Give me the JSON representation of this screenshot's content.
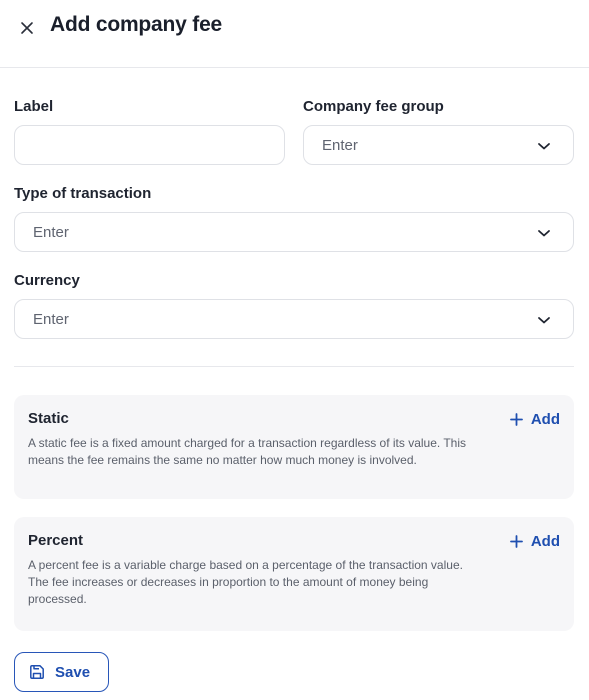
{
  "header": {
    "title": "Add company fee",
    "close_icon": "close-icon"
  },
  "form": {
    "label": {
      "label": "Label",
      "value": "",
      "placeholder": ""
    },
    "company_fee_group": {
      "label": "Company fee group",
      "value": "Enter"
    },
    "type_of_transaction": {
      "label": "Type of transaction",
      "value": "Enter"
    },
    "currency": {
      "label": "Currency",
      "value": "Enter"
    }
  },
  "fees": {
    "static": {
      "title": "Static",
      "description": "A static fee is a fixed amount charged for a transaction regardless of its value. This means the fee remains the same no matter how much money is involved.",
      "add_label": "Add"
    },
    "percent": {
      "title": "Percent",
      "description": "A percent fee is a variable charge based on a percentage of the transaction value. The fee increases or decreases in proportion to the amount of money being processed.",
      "add_label": "Add"
    }
  },
  "footer": {
    "save_label": "Save"
  },
  "colors": {
    "accent": "#1f4fb0",
    "card_bg": "#f6f6f8",
    "border": "#dfe1e6"
  }
}
